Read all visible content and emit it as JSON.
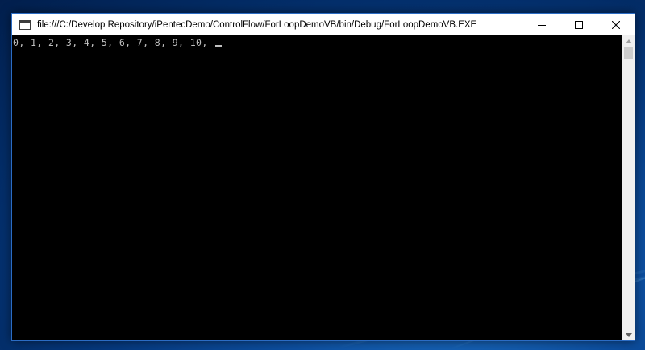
{
  "window": {
    "title": "file:///C:/Develop Repository/iPentecDemo/ControlFlow/ForLoopDemoVB/bin/Debug/ForLoopDemoVB.EXE",
    "icon": "console-app-icon"
  },
  "caption_buttons": {
    "minimize": "minimize-icon",
    "maximize": "maximize-icon",
    "close": "close-icon"
  },
  "console": {
    "output": "0, 1, 2, 3, 4, 5, 6, 7, 8, 9, 10, ",
    "background": "#000000",
    "foreground": "#c0c0c0"
  },
  "desktop": {
    "accent": "#0d4fa0"
  }
}
